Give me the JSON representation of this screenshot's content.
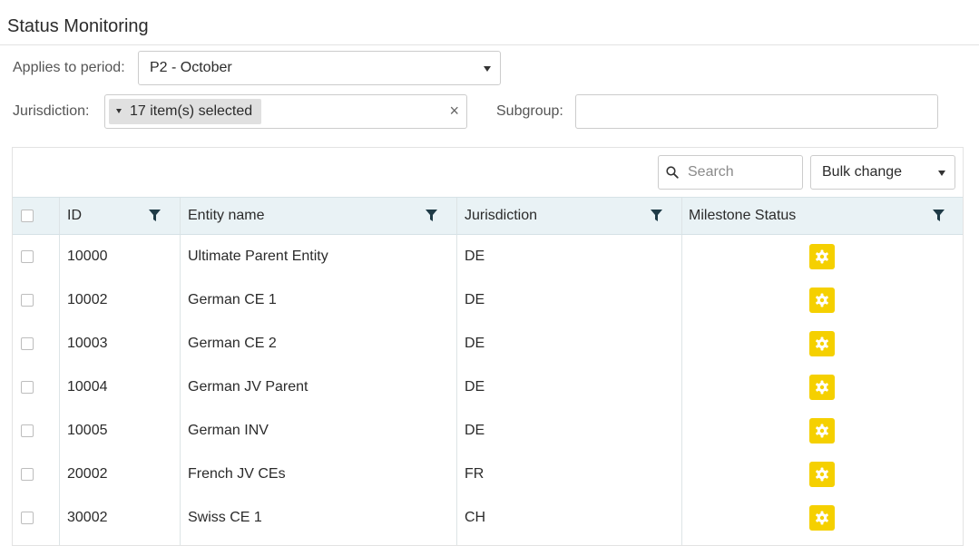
{
  "header": {
    "title": "Status Monitoring"
  },
  "filters": {
    "period_label": "Applies to period:",
    "period_value": "P2 - October",
    "jurisdiction_label": "Jurisdiction:",
    "jurisdiction_chip": "17 item(s) selected",
    "clear_symbol": "×",
    "subgroup_label": "Subgroup:",
    "subgroup_value": ""
  },
  "toolbar": {
    "search_placeholder": "Search",
    "bulk_label": "Bulk change"
  },
  "table": {
    "columns": [
      "ID",
      "Entity name",
      "Jurisdiction",
      "Milestone Status"
    ],
    "rows": [
      {
        "id": "10000",
        "entity_name": "Ultimate Parent Entity",
        "jurisdiction": "DE"
      },
      {
        "id": "10002",
        "entity_name": "German CE 1",
        "jurisdiction": "DE"
      },
      {
        "id": "10003",
        "entity_name": "German CE 2",
        "jurisdiction": "DE"
      },
      {
        "id": "10004",
        "entity_name": "German JV Parent",
        "jurisdiction": "DE"
      },
      {
        "id": "10005",
        "entity_name": "German INV",
        "jurisdiction": "DE"
      },
      {
        "id": "20002",
        "entity_name": "French JV CEs",
        "jurisdiction": "FR"
      },
      {
        "id": "30002",
        "entity_name": "Swiss CE 1",
        "jurisdiction": "CH"
      }
    ]
  },
  "icons": {
    "search": "search-icon",
    "filter": "filter-icon",
    "status": "gear-icon",
    "dropdown": "chevron-down-icon"
  },
  "colors": {
    "header_bg": "#e9f2f5",
    "status_button": "#f5d000",
    "filter_icon": "#1f3b47"
  }
}
